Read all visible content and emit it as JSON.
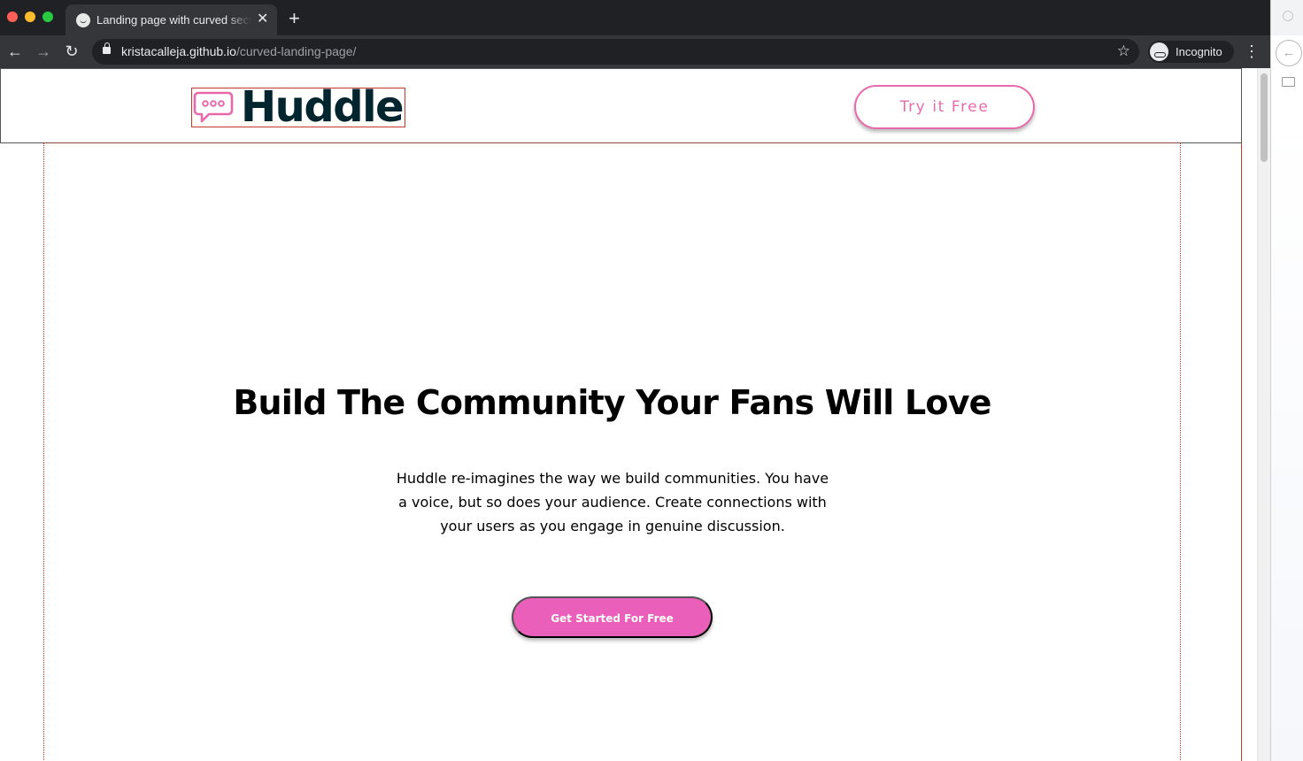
{
  "browser": {
    "tab_title": "Landing page with curved sections",
    "tab_close": "✕",
    "new_tab": "+",
    "url_domain": "kristacalleja.github.io",
    "url_path": "/curved-landing-page/",
    "profile_label": "Incognito",
    "nav": {
      "back": "←",
      "forward": "→",
      "reload": "↻",
      "star": "☆",
      "menu": "⋮"
    }
  },
  "side_panel": {
    "back": "←"
  },
  "site": {
    "brand": "Huddle",
    "header_cta": "Try it Free",
    "hero_title": "Build The Community Your Fans Will Love",
    "hero_text": "Huddle re-imagines the way we build communities. You have a voice, but so does your audience. Create connections with your users as you engage in genuine discussion.",
    "hero_cta": "Get Started For Free"
  },
  "colors": {
    "brand_pink": "#e86aab",
    "cta_pink": "#ea5fb9",
    "logo_text": "#00252e",
    "chrome_dark": "#202124",
    "chrome_toolbar": "#35363a"
  },
  "icons": [
    "speech-bubble-logo-icon",
    "lock-icon",
    "star-icon",
    "incognito-icon",
    "back-arrow-icon",
    "forward-arrow-icon",
    "reload-icon",
    "menu-dots-icon",
    "folder-icon"
  ]
}
